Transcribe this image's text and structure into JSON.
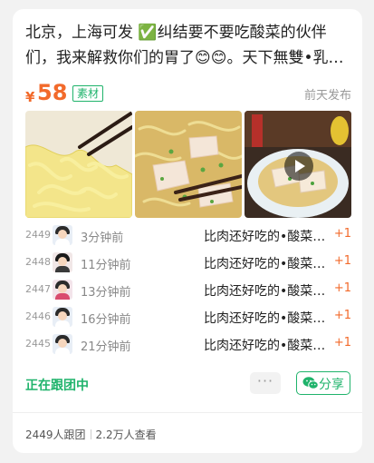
{
  "post": {
    "title": "北京，上海可发 ✅纠结要不要吃酸菜的伙伴们，我来解救你们的胃了😊😊。天下無雙•乳酸菌发酵酸菜",
    "currency": "¥",
    "price": "58",
    "tag": "素材",
    "posted": "前天发布"
  },
  "photos": [
    {
      "name": "photo-shredded-sauerkraut"
    },
    {
      "name": "photo-sauerkraut-pork-stew"
    },
    {
      "name": "photo-video-dish"
    }
  ],
  "orders": [
    {
      "num": "2449",
      "time": "3分钟前",
      "item": "比肉还好吃的•酸菜…",
      "qty": "+1",
      "hair": "#2b2b2b",
      "avatar_bg": "#e8eef6",
      "shirt": "#ffffff"
    },
    {
      "num": "2448",
      "time": "11分钟前",
      "item": "比肉还好吃的•酸菜…",
      "qty": "+1",
      "hair": "#1a1a1a",
      "avatar_bg": "#f1e7e7",
      "shirt": "#3a3a3a"
    },
    {
      "num": "2447",
      "time": "13分钟前",
      "item": "比肉还好吃的•酸菜…",
      "qty": "+1",
      "hair": "#2b2b2b",
      "avatar_bg": "#f3e4ea",
      "shirt": "#d94c6e"
    },
    {
      "num": "2446",
      "time": "16分钟前",
      "item": "比肉还好吃的•酸菜…",
      "qty": "+1",
      "hair": "#2b2b2b",
      "avatar_bg": "#e8eef6",
      "shirt": "#ffffff"
    },
    {
      "num": "2445",
      "time": "21分钟前",
      "item": "比肉还好吃的•酸菜…",
      "qty": "+1",
      "hair": "#2b2b2b",
      "avatar_bg": "#e8eef6",
      "shirt": "#ffffff"
    }
  ],
  "footer": {
    "following_label": "正在跟团中",
    "more_label": "···",
    "share_label": "分享",
    "share_icon": "wechat-icon",
    "followers": "2449人跟团",
    "views": "2.2万人查看"
  },
  "colors": {
    "accent_green": "#1fb36b",
    "price_orange": "#f26a2b"
  }
}
